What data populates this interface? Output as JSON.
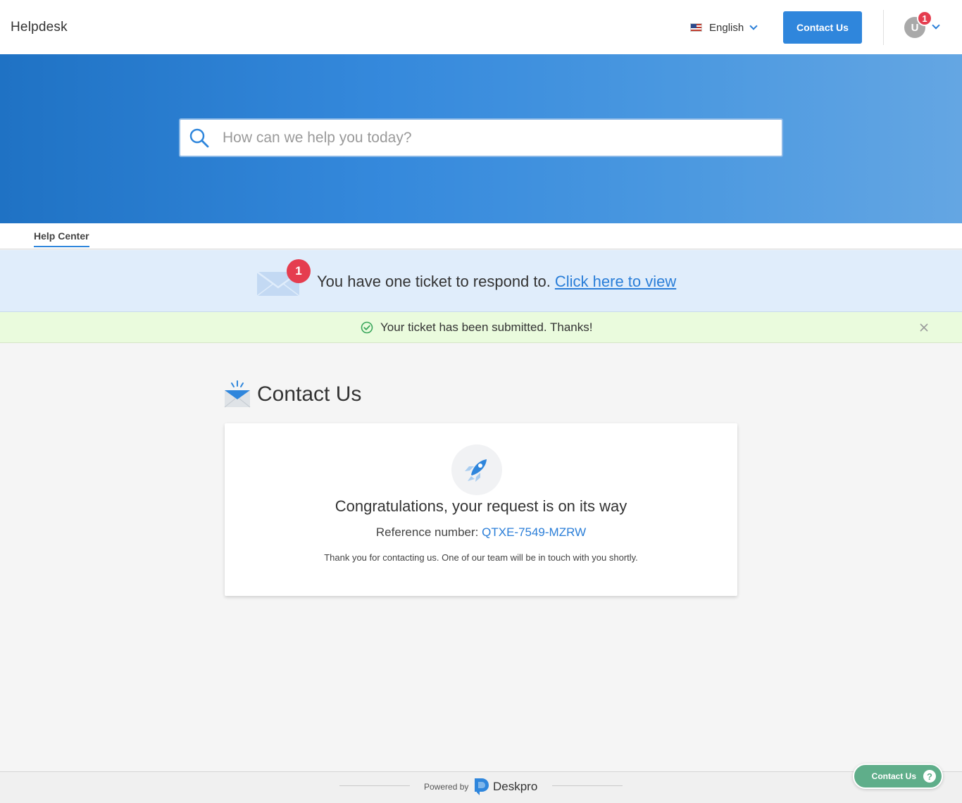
{
  "header": {
    "brand": "Helpdesk",
    "language": "English",
    "contact_button": "Contact Us",
    "avatar_initial": "U",
    "notification_count": "1"
  },
  "search": {
    "placeholder": "How can we help you today?"
  },
  "tabs": [
    {
      "label": "Help Center",
      "active": true
    }
  ],
  "notice": {
    "badge_count": "1",
    "text": "You have one ticket to respond to.",
    "link": "Click here to view"
  },
  "success": {
    "text": "Your ticket has been submitted. Thanks!"
  },
  "main": {
    "title": "Contact Us",
    "card": {
      "headline": "Congratulations, your request is on its way",
      "reference_label": "Reference number:",
      "reference_value": "QTXE-7549-MZRW",
      "thanks": "Thank you for contacting us. One of our team will be in touch with you shortly."
    }
  },
  "footer": {
    "powered_by": "Powered by",
    "brand": "Deskpro"
  },
  "floating": {
    "label": "Contact Us",
    "help_glyph": "?"
  },
  "colors": {
    "accent": "#2f86dc",
    "badge": "#e53d4f",
    "success_bg": "#eafbdd",
    "notice_bg": "#e0edfb",
    "floating_btn": "#5fae8a"
  }
}
